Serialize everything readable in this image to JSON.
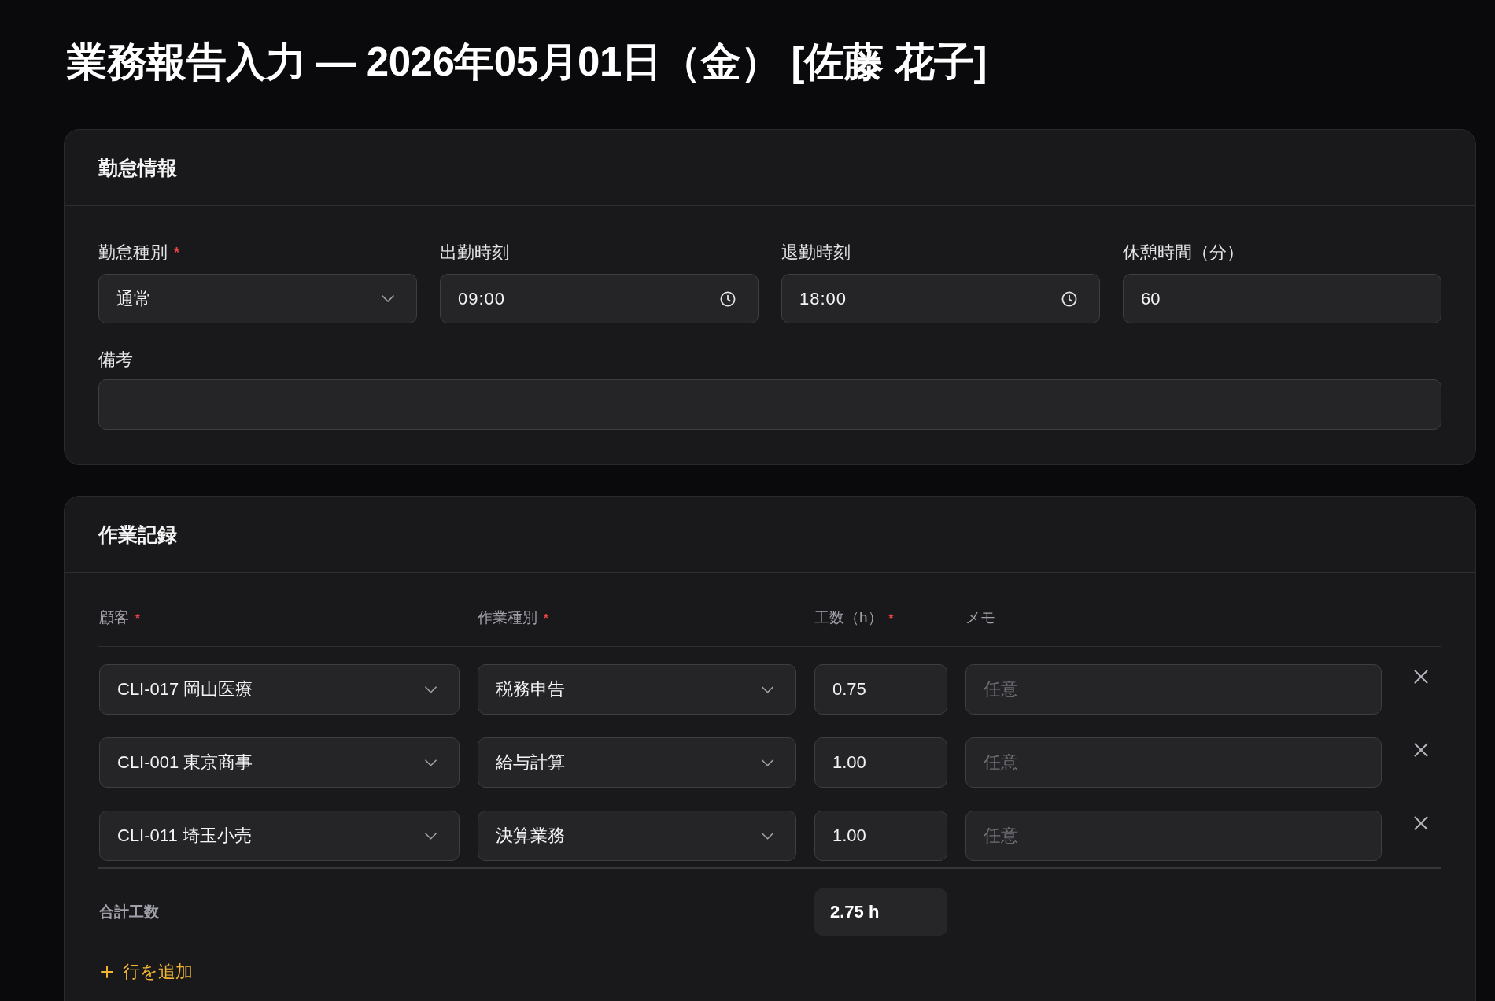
{
  "page_title": "業務報告入力 — 2026年05月01日（金） [佐藤 花子]",
  "attendance": {
    "title": "勤怠情報",
    "fields": [
      {
        "kind": "select",
        "label": "勤怠種別",
        "required_mark": "*",
        "value": "通常"
      },
      {
        "kind": "time",
        "label": "出勤時刻",
        "value": "09:00"
      },
      {
        "kind": "time",
        "label": "退勤時刻",
        "value": "18:00"
      },
      {
        "kind": "text",
        "label": "休憩時間（分）",
        "value": "60"
      }
    ],
    "note": {
      "label": "備考"
    }
  },
  "work_records": {
    "title": "作業記録",
    "columns": [
      {
        "label": "顧客",
        "required_mark": "*"
      },
      {
        "label": "作業種別",
        "required_mark": "*"
      },
      {
        "label": "工数（h）",
        "required_mark": "*"
      },
      {
        "label": "メモ"
      }
    ],
    "rows": [
      {
        "client": "CLI-017 岡山医療",
        "work_type": "税務申告",
        "hours": "0.75",
        "memo": {
          "placeholder": "任意"
        }
      },
      {
        "client": "CLI-001 東京商事",
        "work_type": "給与計算",
        "hours": "1.00",
        "memo": {
          "placeholder": "任意"
        }
      },
      {
        "client": "CLI-011 埼玉小売",
        "work_type": "決算業務",
        "hours": "1.00",
        "memo": {
          "placeholder": "任意"
        }
      }
    ],
    "total": {
      "label": "合計工数",
      "value": "2.75 h"
    },
    "add_row": {
      "label": "行を追加"
    }
  }
}
